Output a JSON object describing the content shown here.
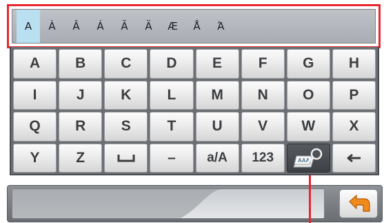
{
  "accent_bar": {
    "chars": [
      "A",
      "À",
      "Â",
      "Á",
      "Ã",
      "Ä",
      "Æ",
      "Å",
      "Ά"
    ],
    "selected_index": 0
  },
  "keyboard": {
    "rows": [
      [
        "A",
        "B",
        "C",
        "D",
        "E",
        "F",
        "G",
        "H"
      ],
      [
        "I",
        "J",
        "K",
        "L",
        "M",
        "N",
        "O",
        "P"
      ],
      [
        "Q",
        "R",
        "S",
        "T",
        "U",
        "V",
        "W",
        "X"
      ]
    ],
    "last_row": {
      "y": "Y",
      "z": "Z",
      "space": "␣",
      "dash": "–",
      "case_toggle": "a/A",
      "numbers": "123",
      "special_badge": "AAA",
      "backspace": "←"
    }
  },
  "text_field": {
    "value": ""
  },
  "colors": {
    "annotation_red": "#e8262e",
    "selected_char_bg": "#b9dff0",
    "back_arrow_orange": "#f08a1c"
  },
  "icons": {
    "back_button": "return-arrow-icon",
    "special_key": "magnifier-icon"
  }
}
